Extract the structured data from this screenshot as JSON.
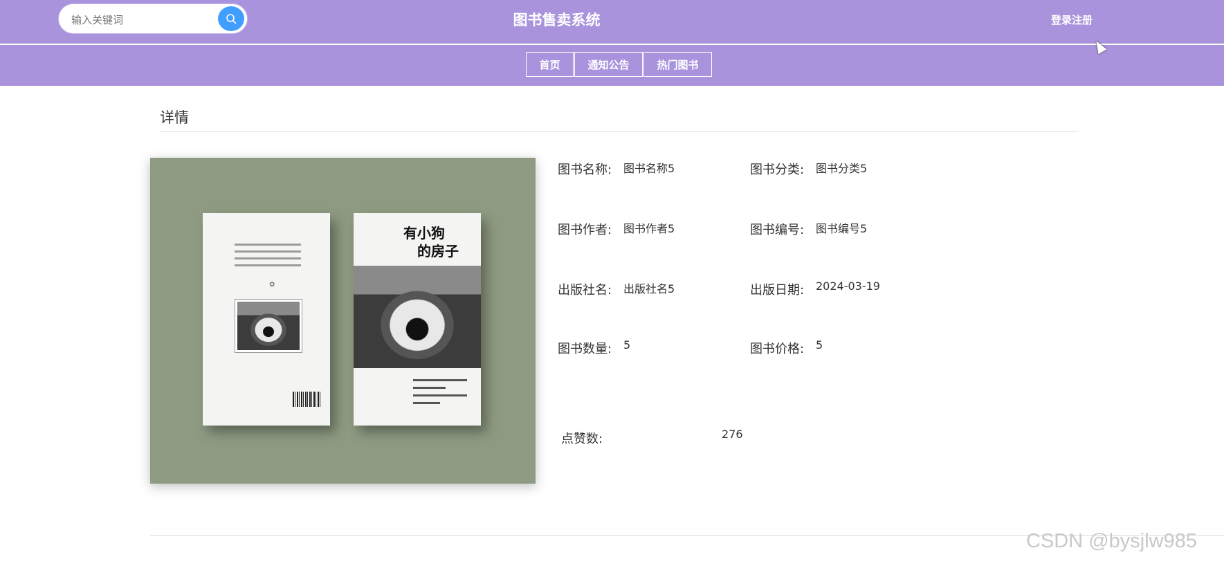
{
  "header": {
    "search_placeholder": "输入关键词",
    "site_title": "图书售卖系统",
    "login_register": "登录注册"
  },
  "nav": {
    "items": [
      {
        "label": "首页"
      },
      {
        "label": "通知公告"
      },
      {
        "label": "热门图书"
      }
    ]
  },
  "detail": {
    "section_title": "详情",
    "fields": {
      "book_name": {
        "label": "图书名称:",
        "value": "图书名称5"
      },
      "book_category": {
        "label": "图书分类:",
        "value": "图书分类5"
      },
      "book_author": {
        "label": "图书作者:",
        "value": "图书作者5"
      },
      "book_number": {
        "label": "图书编号:",
        "value": "图书编号5"
      },
      "publisher": {
        "label": "出版社名:",
        "value": "出版社名5"
      },
      "publish_date": {
        "label": "出版日期:",
        "value": "2024-03-19"
      },
      "quantity": {
        "label": "图书数量:",
        "value": "5"
      },
      "price": {
        "label": "图书价格:",
        "value": "5"
      }
    },
    "likes": {
      "label": "点赞数:",
      "value": "276"
    },
    "cover": {
      "front_title_line1": "有小狗",
      "front_title_line2": "的房子"
    }
  },
  "watermark": "CSDN @bysjlw985",
  "colors": {
    "header_bg": "#a993dd",
    "search_button": "#409eff",
    "cover_bg": "#8e9b82"
  }
}
